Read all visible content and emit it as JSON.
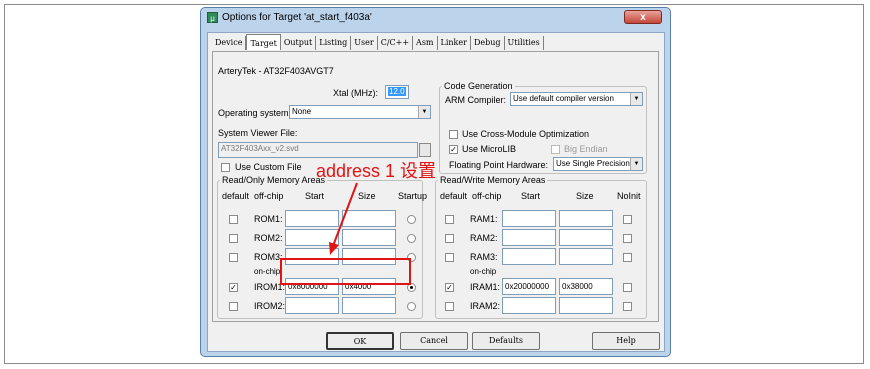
{
  "window": {
    "title": "Options for Target 'at_start_f403a'",
    "close_glyph": "x",
    "tabs": [
      "Device",
      "Target",
      "Output",
      "Listing",
      "User",
      "C/C++",
      "Asm",
      "Linker",
      "Debug",
      "Utilities"
    ],
    "active_tab": "Target"
  },
  "target": {
    "device": "ArteryTek - AT32F403AVGT7",
    "xtal_label": "Xtal (MHz):",
    "xtal_value": "12.0",
    "os_label": "Operating system:",
    "os_value": "None",
    "svf_label": "System Viewer File:",
    "svf_value": "AT32F403Axx_v2.svd",
    "custom_file_label": "Use Custom File"
  },
  "codegen": {
    "group_label": "Code Generation",
    "compiler_label": "ARM Compiler:",
    "compiler_value": "Use default compiler version",
    "cross_module_label": "Use Cross-Module Optimization",
    "microlib_label": "Use MicroLIB",
    "big_endian_label": "Big Endian",
    "fp_label": "Floating Point Hardware:",
    "fp_value": "Use Single Precision"
  },
  "ro_memory": {
    "group_label": "Read/Only Memory Areas",
    "headers": {
      "default": "default",
      "offchip": "off-chip",
      "start": "Start",
      "size": "Size",
      "startup": "Startup"
    },
    "onchip_label": "on-chip",
    "rows": [
      {
        "name": "ROM1:",
        "start": "",
        "size": "",
        "default": false,
        "startup": false
      },
      {
        "name": "ROM2:",
        "start": "",
        "size": "",
        "default": false,
        "startup": false
      },
      {
        "name": "ROM3:",
        "start": "",
        "size": "",
        "default": false,
        "startup": false
      },
      {
        "name": "IROM1:",
        "start": "0x8000000",
        "size": "0x4000",
        "default": true,
        "startup": true
      },
      {
        "name": "IROM2:",
        "start": "",
        "size": "",
        "default": false,
        "startup": false
      }
    ]
  },
  "rw_memory": {
    "group_label": "Read/Write Memory Areas",
    "headers": {
      "default": "default",
      "offchip": "off-chip",
      "start": "Start",
      "size": "Size",
      "noinit": "NoInit"
    },
    "onchip_label": "on-chip",
    "rows": [
      {
        "name": "RAM1:",
        "start": "",
        "size": "",
        "default": false,
        "noinit": false
      },
      {
        "name": "RAM2:",
        "start": "",
        "size": "",
        "default": false,
        "noinit": false
      },
      {
        "name": "RAM3:",
        "start": "",
        "size": "",
        "default": false,
        "noinit": false
      },
      {
        "name": "IRAM1:",
        "start": "0x20000000",
        "size": "0x38000",
        "default": true,
        "noinit": false
      },
      {
        "name": "IRAM2:",
        "start": "",
        "size": "",
        "default": false,
        "noinit": false
      }
    ]
  },
  "buttons": {
    "ok": "OK",
    "cancel": "Cancel",
    "defaults": "Defaults",
    "help": "Help"
  },
  "annotation": {
    "text": "address 1 设置",
    "color": "#e11414"
  }
}
